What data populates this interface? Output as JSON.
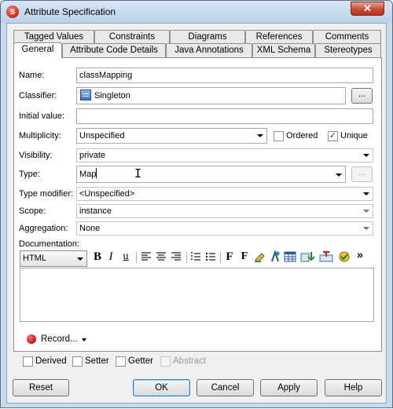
{
  "window": {
    "title": "Attribute Specification",
    "close_glyph": "✕"
  },
  "tabs_row1": [
    "Tagged Values",
    "Constraints",
    "Diagrams",
    "References",
    "Comments"
  ],
  "tabs_row2": [
    "General",
    "Attribute Code Details",
    "Java Annotations",
    "XML Schema",
    "Stereotypes"
  ],
  "form": {
    "name_label": "Name:",
    "name_value": "classMapping",
    "classifier_label": "Classifier:",
    "classifier_value": "Singleton",
    "classifier_browse": "...",
    "initial_label": "Initial value:",
    "initial_value": "",
    "multiplicity_label": "Multiplicity:",
    "multiplicity_value": "Unspecified",
    "ordered_label": "Ordered",
    "ordered_checked": false,
    "unique_label": "Unique",
    "unique_checked": true,
    "visibility_label": "Visibility:",
    "visibility_value": "private",
    "type_label": "Type:",
    "type_value": "Map",
    "type_browse": "...",
    "type_modifier_label": "Type modifier:",
    "type_modifier_value": "<Unspecified>",
    "scope_label": "Scope:",
    "scope_value": "instance",
    "aggregation_label": "Aggregation:",
    "aggregation_value": "None",
    "documentation_label": "Documentation:"
  },
  "doc_toolbar": {
    "format_value": "HTML",
    "bold": "B",
    "italic": "I",
    "underline": "u",
    "font": "F",
    "font_size": "F",
    "more": "»",
    "icons": [
      "align-left-icon",
      "align-center-icon",
      "align-right-icon",
      "ordered-list-icon",
      "unordered-list-icon",
      "font-icon",
      "font-size-icon",
      "highlight-icon",
      "text-color-icon",
      "table-icon",
      "insert-icon",
      "link-icon",
      "spell-check-icon"
    ]
  },
  "record": {
    "label": "Record...",
    "dot_color": "#c0141c"
  },
  "checks": {
    "derived": "Derived",
    "setter": "Setter",
    "getter": "Getter",
    "abstract": "Abstract"
  },
  "buttons": {
    "reset": "Reset",
    "ok": "OK",
    "cancel": "Cancel",
    "apply": "Apply",
    "help": "Help"
  }
}
